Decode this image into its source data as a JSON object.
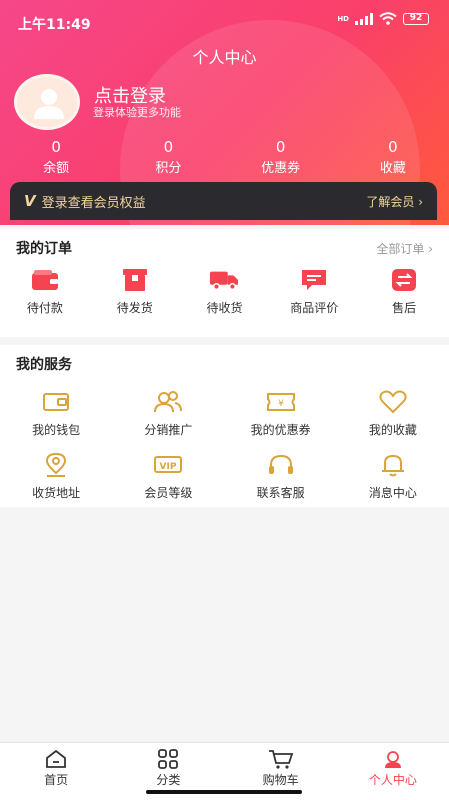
{
  "status_bar": {
    "time": "上午11:49",
    "network": "HD",
    "battery": "92"
  },
  "header": {
    "title": "个人中心",
    "login_title": "点击登录",
    "login_subtitle": "登录体验更多功能",
    "stats": [
      {
        "value": "0",
        "label": "余额"
      },
      {
        "value": "0",
        "label": "积分"
      },
      {
        "value": "0",
        "label": "优惠券"
      },
      {
        "value": "0",
        "label": "收藏"
      }
    ]
  },
  "vip_banner": {
    "text": "登录查看会员权益",
    "link": "了解会员",
    "badge": "V"
  },
  "orders": {
    "title": "我的订单",
    "all_link": "全部订单",
    "items": [
      {
        "label": "待付款",
        "icon": "wallet-icon"
      },
      {
        "label": "待发货",
        "icon": "box-icon"
      },
      {
        "label": "待收货",
        "icon": "truck-icon"
      },
      {
        "label": "商品评价",
        "icon": "comment-icon"
      },
      {
        "label": "售后",
        "icon": "exchange-icon"
      }
    ]
  },
  "services": {
    "title": "我的服务",
    "items": [
      {
        "label": "我的钱包",
        "icon": "wallet-outline-icon"
      },
      {
        "label": "分销推广",
        "icon": "users-icon"
      },
      {
        "label": "我的优惠券",
        "icon": "coupon-icon"
      },
      {
        "label": "我的收藏",
        "icon": "heart-icon"
      },
      {
        "label": "收货地址",
        "icon": "location-icon"
      },
      {
        "label": "会员等级",
        "icon": "vip-icon"
      },
      {
        "label": "联系客服",
        "icon": "headset-icon"
      },
      {
        "label": "消息中心",
        "icon": "bell-icon"
      }
    ]
  },
  "tabbar": {
    "items": [
      {
        "label": "首页",
        "icon": "home-icon"
      },
      {
        "label": "分类",
        "icon": "grid-icon"
      },
      {
        "label": "购物车",
        "icon": "cart-icon"
      },
      {
        "label": "个人中心",
        "icon": "user-icon"
      }
    ],
    "active": "个人中心"
  },
  "colors": {
    "accent": "#f5444f",
    "gold": "#d9a53a",
    "vip_bg": "#2b2b2f"
  }
}
